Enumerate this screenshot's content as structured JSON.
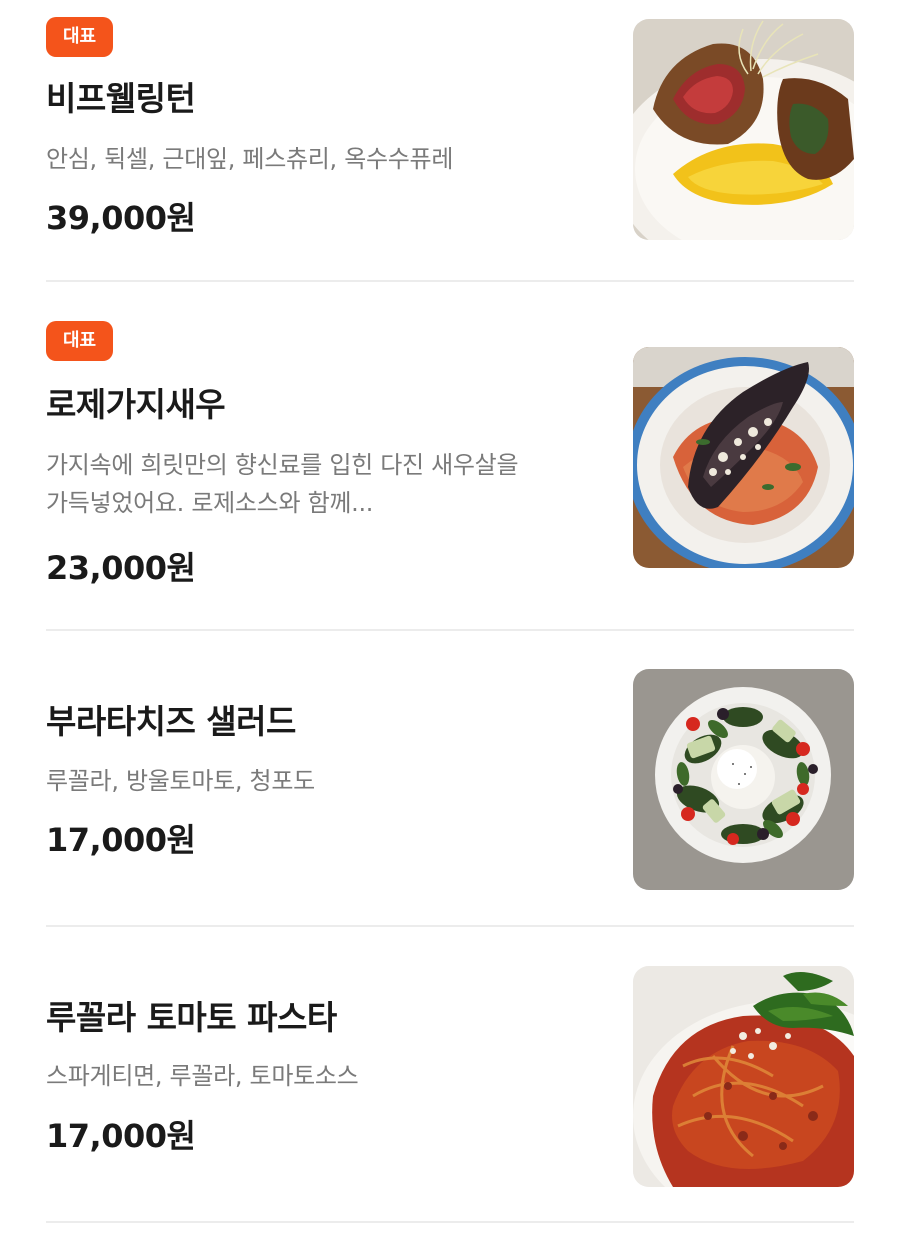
{
  "menu": {
    "badge_label": "대표",
    "price_suffix": "원",
    "items": [
      {
        "badge": "대표",
        "name": "비프웰링턴",
        "description": "안심, 뒥셀, 근대잎, 페스츄리, 옥수수퓨레",
        "price": "39,000원",
        "image": "beef-wellington-photo"
      },
      {
        "badge": "대표",
        "name": "로제가지새우",
        "description": "가지속에 희릿만의 향신료를 입힌 다진 새우살을 가득넣었어요. 로제소스와 함께...",
        "price": "23,000원",
        "image": "rose-eggplant-shrimp-photo"
      },
      {
        "name": "부라타치즈 샐러드",
        "description": "루꼴라, 방울토마토, 청포도",
        "price": "17,000원",
        "image": "burrata-salad-photo"
      },
      {
        "name": "루꼴라 토마토 파스타",
        "description": "스파게티면, 루꼴라, 토마토소스",
        "price": "17,000원",
        "image": "arugula-tomato-pasta-photo"
      }
    ]
  },
  "colors": {
    "badge_bg": "#f4541b",
    "title": "#1a1a1a",
    "description": "#7a7a7a",
    "divider": "#ececec"
  }
}
